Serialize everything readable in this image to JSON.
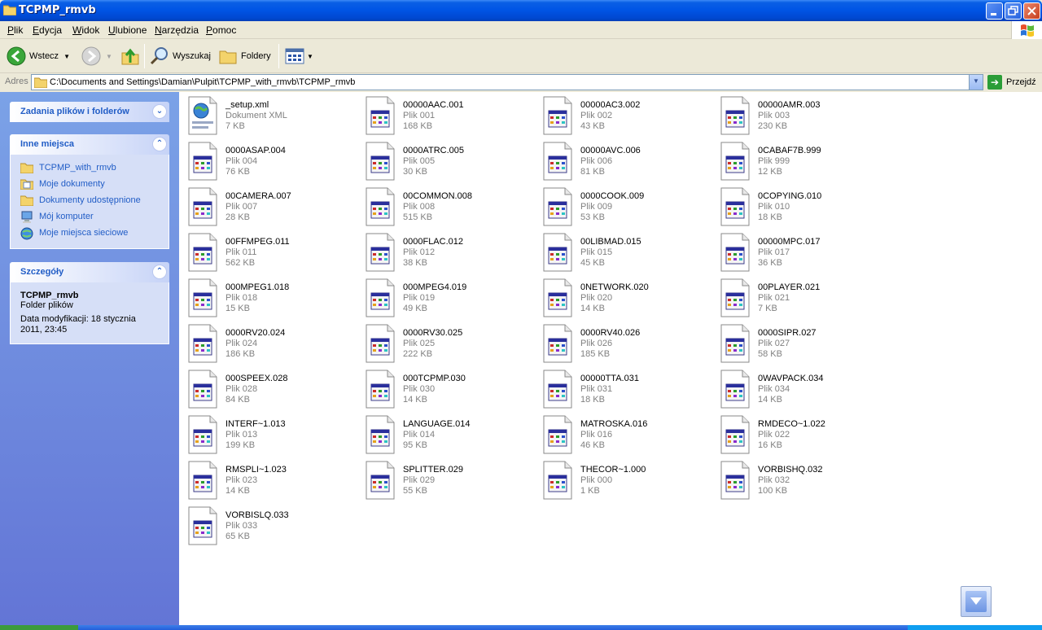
{
  "window": {
    "title": "TCPMP_rmvb"
  },
  "menu": [
    {
      "label_u": "P",
      "label_rest": "lik"
    },
    {
      "label_u": "E",
      "label_rest": "dycja"
    },
    {
      "label_u": "W",
      "label_rest": "idok"
    },
    {
      "label_u": "U",
      "label_rest": "lubione"
    },
    {
      "label_u": "N",
      "label_rest": "arzędzia"
    },
    {
      "label_u": "P",
      "label_rest": "omoc"
    }
  ],
  "toolbar": {
    "back_label": "Wstecz",
    "search_label": "Wyszukaj",
    "folders_label": "Foldery"
  },
  "address": {
    "label": "Adres",
    "path": "C:\\Documents and Settings\\Damian\\Pulpit\\TCPMP_with_rmvb\\TCPMP_rmvb",
    "go_label": "Przejdź"
  },
  "taskpane": {
    "file_tasks_title": "Zadania plików i folderów",
    "other_places_title": "Inne miejsca",
    "other_places": [
      {
        "label": "TCPMP_with_rmvb",
        "icon": "folder-icon"
      },
      {
        "label": "Moje dokumenty",
        "icon": "documents-icon"
      },
      {
        "label": "Dokumenty udostępnione",
        "icon": "folder-icon"
      },
      {
        "label": "Mój komputer",
        "icon": "computer-icon"
      },
      {
        "label": "Moje miejsca sieciowe",
        "icon": "network-icon"
      }
    ],
    "details_title": "Szczegóły",
    "details": {
      "name": "TCPMP_rmvb",
      "type": "Folder plików",
      "modified": "Data modyfikacji: 18 stycznia 2011, 23:45"
    }
  },
  "files": [
    {
      "name": "_setup.xml",
      "type": "Dokument XML",
      "size": "7 KB",
      "icon": "xml"
    },
    {
      "name": "00000AAC.001",
      "type": "Plik 001",
      "size": "168 KB",
      "icon": "file"
    },
    {
      "name": "00000AC3.002",
      "type": "Plik 002",
      "size": "43 KB",
      "icon": "file"
    },
    {
      "name": "00000AMR.003",
      "type": "Plik 003",
      "size": "230 KB",
      "icon": "file"
    },
    {
      "name": "0000ASAP.004",
      "type": "Plik 004",
      "size": "76 KB",
      "icon": "file"
    },
    {
      "name": "0000ATRC.005",
      "type": "Plik 005",
      "size": "30 KB",
      "icon": "file"
    },
    {
      "name": "00000AVC.006",
      "type": "Plik 006",
      "size": "81 KB",
      "icon": "file"
    },
    {
      "name": "0CABAF7B.999",
      "type": "Plik 999",
      "size": "12 KB",
      "icon": "file"
    },
    {
      "name": "00CAMERA.007",
      "type": "Plik 007",
      "size": "28 KB",
      "icon": "file"
    },
    {
      "name": "00COMMON.008",
      "type": "Plik 008",
      "size": "515 KB",
      "icon": "file"
    },
    {
      "name": "0000COOK.009",
      "type": "Plik 009",
      "size": "53 KB",
      "icon": "file"
    },
    {
      "name": "0COPYING.010",
      "type": "Plik 010",
      "size": "18 KB",
      "icon": "file"
    },
    {
      "name": "00FFMPEG.011",
      "type": "Plik 011",
      "size": "562 KB",
      "icon": "file"
    },
    {
      "name": "0000FLAC.012",
      "type": "Plik 012",
      "size": "38 KB",
      "icon": "file"
    },
    {
      "name": "00LIBMAD.015",
      "type": "Plik 015",
      "size": "45 KB",
      "icon": "file"
    },
    {
      "name": "00000MPC.017",
      "type": "Plik 017",
      "size": "36 KB",
      "icon": "file"
    },
    {
      "name": "000MPEG1.018",
      "type": "Plik 018",
      "size": "15 KB",
      "icon": "file"
    },
    {
      "name": "000MPEG4.019",
      "type": "Plik 019",
      "size": "49 KB",
      "icon": "file"
    },
    {
      "name": "0NETWORK.020",
      "type": "Plik 020",
      "size": "14 KB",
      "icon": "file"
    },
    {
      "name": "00PLAYER.021",
      "type": "Plik 021",
      "size": "7 KB",
      "icon": "file"
    },
    {
      "name": "0000RV20.024",
      "type": "Plik 024",
      "size": "186 KB",
      "icon": "file"
    },
    {
      "name": "0000RV30.025",
      "type": "Plik 025",
      "size": "222 KB",
      "icon": "file"
    },
    {
      "name": "0000RV40.026",
      "type": "Plik 026",
      "size": "185 KB",
      "icon": "file"
    },
    {
      "name": "0000SIPR.027",
      "type": "Plik 027",
      "size": "58 KB",
      "icon": "file"
    },
    {
      "name": "000SPEEX.028",
      "type": "Plik 028",
      "size": "84 KB",
      "icon": "file"
    },
    {
      "name": "000TCPMP.030",
      "type": "Plik 030",
      "size": "14 KB",
      "icon": "file"
    },
    {
      "name": "00000TTA.031",
      "type": "Plik 031",
      "size": "18 KB",
      "icon": "file"
    },
    {
      "name": "0WAVPACK.034",
      "type": "Plik 034",
      "size": "14 KB",
      "icon": "file"
    },
    {
      "name": "INTERF~1.013",
      "type": "Plik 013",
      "size": "199 KB",
      "icon": "file"
    },
    {
      "name": "LANGUAGE.014",
      "type": "Plik 014",
      "size": "95 KB",
      "icon": "file"
    },
    {
      "name": "MATROSKA.016",
      "type": "Plik 016",
      "size": "46 KB",
      "icon": "file"
    },
    {
      "name": "RMDECO~1.022",
      "type": "Plik 022",
      "size": "16 KB",
      "icon": "file"
    },
    {
      "name": "RMSPLI~1.023",
      "type": "Plik 023",
      "size": "14 KB",
      "icon": "file"
    },
    {
      "name": "SPLITTER.029",
      "type": "Plik 029",
      "size": "55 KB",
      "icon": "file"
    },
    {
      "name": "THECOR~1.000",
      "type": "Plik 000",
      "size": "1 KB",
      "icon": "file"
    },
    {
      "name": "VORBISHQ.032",
      "type": "Plik 032",
      "size": "100 KB",
      "icon": "file"
    },
    {
      "name": "VORBISLQ.033",
      "type": "Plik 033",
      "size": "65 KB",
      "icon": "file"
    }
  ]
}
